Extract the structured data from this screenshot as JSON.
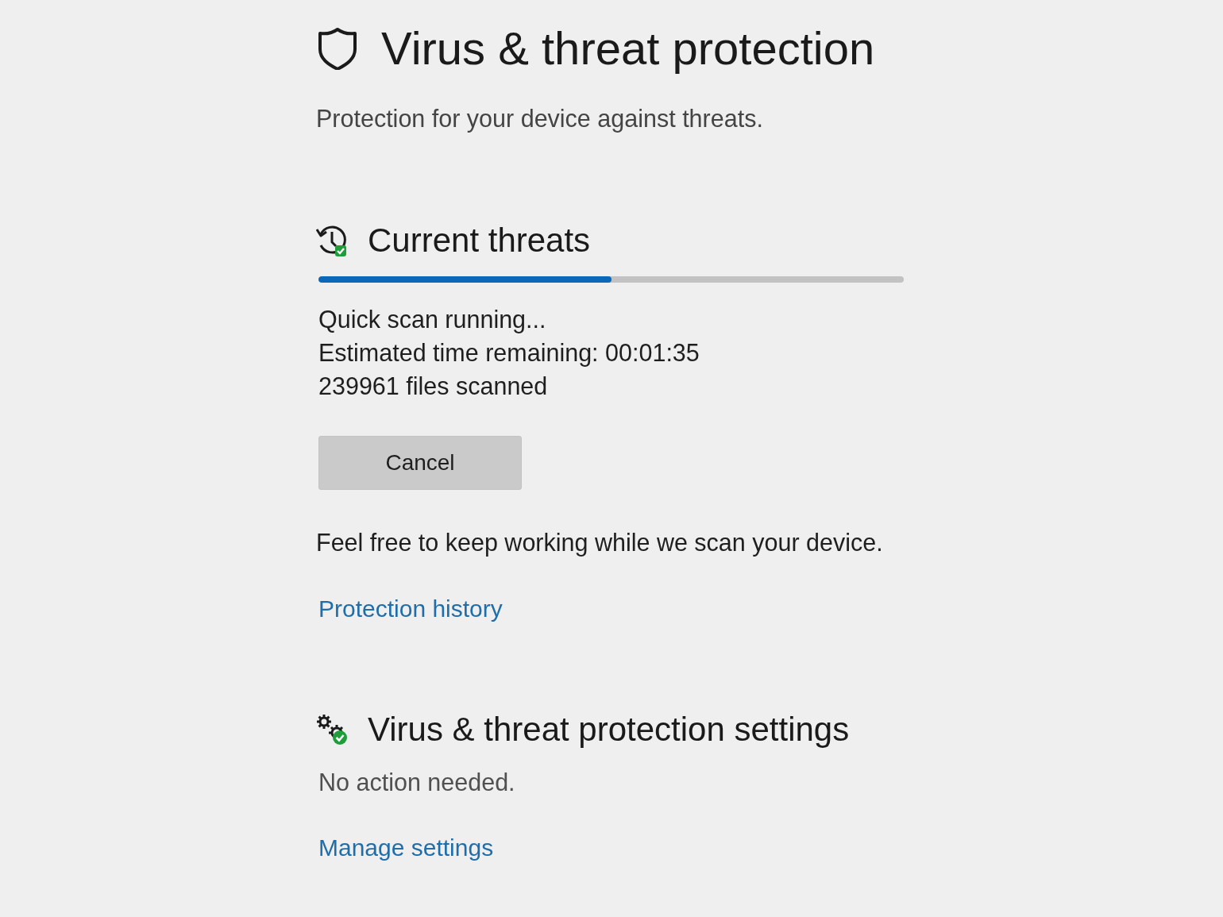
{
  "page": {
    "title": "Virus & threat protection",
    "subtitle": "Protection for your device against threats."
  },
  "sections": [
    {
      "kind": "scan",
      "heading": "Current threats",
      "progress": {
        "level": 0.5
      },
      "status_lines": [
        "Quick scan running...",
        "Estimated time remaining: 00:01:35",
        "239961 files scanned"
      ],
      "button": "Cancel",
      "note": "Feel free to keep working while we scan your device.",
      "link": "Protection history"
    },
    {
      "kind": "settings",
      "heading": "Virus & threat protection settings",
      "status_lines": [
        "No action needed."
      ],
      "link": "Manage settings"
    }
  ]
}
